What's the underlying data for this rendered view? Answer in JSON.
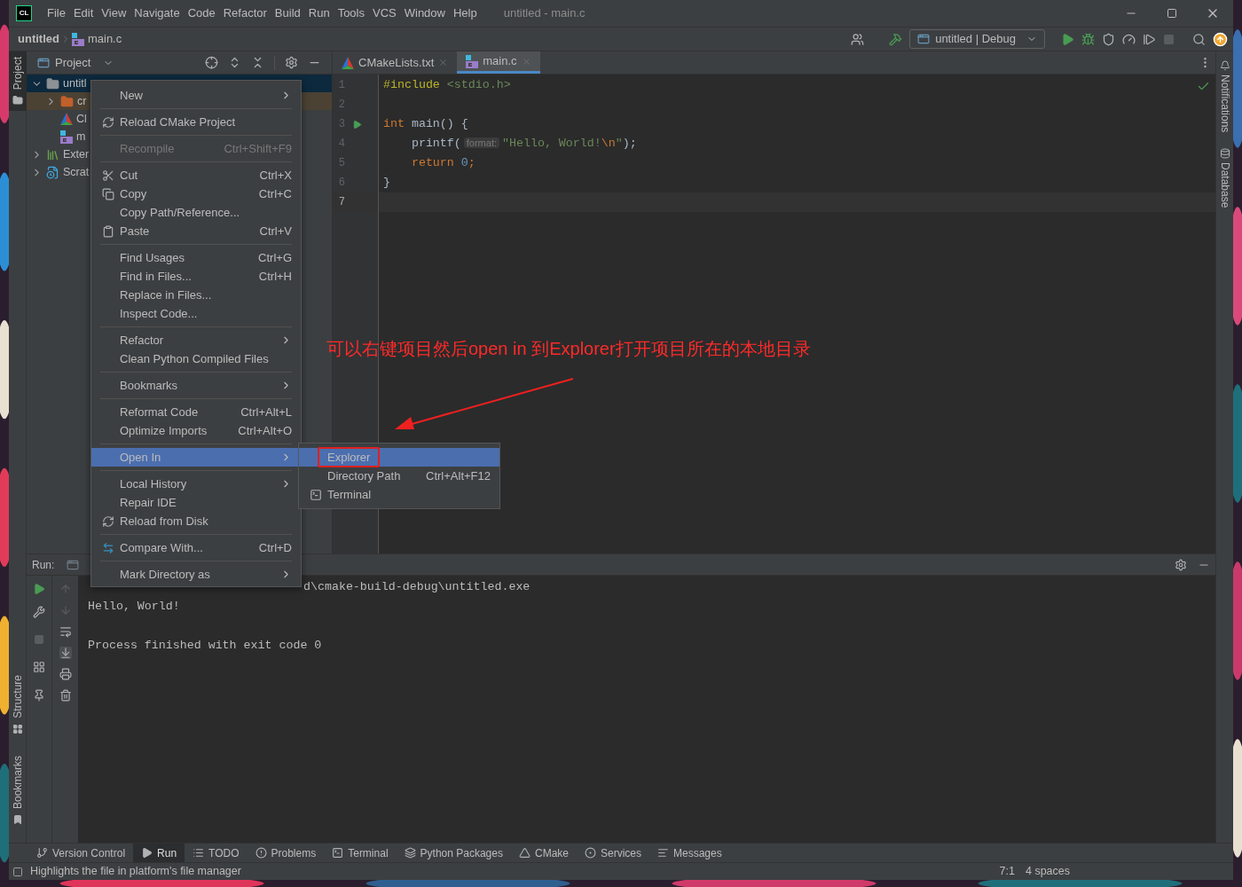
{
  "window": {
    "logo_text": "CL",
    "menu": [
      "File",
      "Edit",
      "View",
      "Navigate",
      "Code",
      "Refactor",
      "Build",
      "Run",
      "Tools",
      "VCS",
      "Window",
      "Help"
    ],
    "title": "untitled - main.c"
  },
  "breadcrumb": {
    "project": "untitled",
    "file": "main.c"
  },
  "toolbar": {
    "run_config": "untitled | Debug"
  },
  "left_stripe": [
    {
      "label": "Project",
      "selected": true
    },
    {
      "label": "Structure",
      "selected": false
    },
    {
      "label": "Bookmarks",
      "selected": false
    }
  ],
  "right_stripe": [
    {
      "label": "Notifications"
    },
    {
      "label": "Database"
    }
  ],
  "project_panel": {
    "title": "Project",
    "tree": [
      {
        "label": "untitl",
        "kind": "folder",
        "selected": true,
        "excluded": false,
        "expanded": true,
        "children": [
          {
            "label": "cr",
            "kind": "build-folder",
            "selected": false,
            "excluded": true,
            "expanded": false
          },
          {
            "label": "Cl",
            "kind": "cmake",
            "selected": false,
            "excluded": false
          },
          {
            "label": "m",
            "kind": "source",
            "selected": false,
            "excluded": false
          }
        ]
      },
      {
        "label": "Exter",
        "kind": "library",
        "selected": false,
        "excluded": false,
        "expanded": false
      },
      {
        "label": "Scrat",
        "kind": "scratch",
        "selected": false,
        "excluded": false,
        "expanded": false
      }
    ]
  },
  "editor": {
    "tabs": [
      {
        "label": "CMakeLists.txt",
        "kind": "cmake",
        "selected": false
      },
      {
        "label": "main.c",
        "kind": "source",
        "selected": true
      }
    ],
    "lines": [
      {
        "number": "1",
        "current": false,
        "run_marker": false,
        "tokens": [
          {
            "text": "#include",
            "kind": "directive"
          },
          {
            "text": " <stdio.h>",
            "kind": "string"
          }
        ]
      },
      {
        "number": "2",
        "current": false,
        "run_marker": false
      },
      {
        "number": "3",
        "current": false,
        "run_marker": true,
        "tokens": [
          {
            "text": "int",
            "kind": "keyword"
          },
          {
            "text": " main() {",
            "kind": "plain"
          }
        ]
      },
      {
        "number": "4",
        "current": false,
        "run_marker": false,
        "tokens": [
          {
            "text": "    printf(",
            "kind": "plain"
          },
          {
            "text": "format:",
            "kind": "hint"
          },
          {
            "text": "\"Hello, World!",
            "kind": "string"
          },
          {
            "text": "\\n",
            "kind": "escape"
          },
          {
            "text": "\"",
            "kind": "string"
          },
          {
            "text": ");",
            "kind": "plain"
          }
        ]
      },
      {
        "number": "5",
        "current": false,
        "run_marker": false,
        "tokens": [
          {
            "text": "    return",
            "kind": "keyword"
          },
          {
            "text": " 0",
            "kind": "number"
          },
          {
            "text": ";",
            "kind": "keyword"
          }
        ]
      },
      {
        "number": "6",
        "current": false,
        "run_marker": false,
        "tokens": [
          {
            "text": "}",
            "kind": "plain"
          }
        ]
      },
      {
        "number": "7",
        "current": true,
        "run_marker": false
      }
    ]
  },
  "run_panel": {
    "title": "Run:",
    "output": [
      {
        "text": "d\\cmake-build-debug\\untitled.exe",
        "kind": "command"
      },
      {
        "text": "Hello, World!",
        "kind": "stdout"
      },
      {
        "text": "Process finished with exit code 0",
        "kind": "exit"
      }
    ]
  },
  "context_menu": {
    "groups": [
      {
        "items": [
          {
            "label": "New",
            "submenu": true,
            "selected": false,
            "disabled": false
          }
        ]
      },
      {
        "items": [
          {
            "label": "Reload CMake Project",
            "kind": "reload",
            "submenu": false,
            "selected": false,
            "disabled": false
          }
        ]
      },
      {
        "items": [
          {
            "label": "Recompile",
            "shortcut": "Ctrl+Shift+F9",
            "submenu": false,
            "selected": false,
            "disabled": true
          }
        ]
      },
      {
        "items": [
          {
            "label": "Cut",
            "kind": "cut",
            "shortcut": "Ctrl+X",
            "submenu": false,
            "selected": false,
            "disabled": false
          },
          {
            "label": "Copy",
            "kind": "copy",
            "shortcut": "Ctrl+C",
            "submenu": false,
            "selected": false,
            "disabled": false
          },
          {
            "label": "Copy Path/Reference...",
            "submenu": false,
            "selected": false,
            "disabled": false
          },
          {
            "label": "Paste",
            "kind": "paste",
            "shortcut": "Ctrl+V",
            "submenu": false,
            "selected": false,
            "disabled": false
          }
        ]
      },
      {
        "items": [
          {
            "label": "Find Usages",
            "shortcut": "Ctrl+G",
            "submenu": false,
            "selected": false,
            "disabled": false
          },
          {
            "label": "Find in Files...",
            "shortcut": "Ctrl+H",
            "submenu": false,
            "selected": false,
            "disabled": false
          },
          {
            "label": "Replace in Files...",
            "submenu": false,
            "selected": false,
            "disabled": false
          },
          {
            "label": "Inspect Code...",
            "submenu": false,
            "selected": false,
            "disabled": false
          }
        ]
      },
      {
        "items": [
          {
            "label": "Refactor",
            "submenu": true,
            "selected": false,
            "disabled": false
          },
          {
            "label": "Clean Python Compiled Files",
            "submenu": false,
            "selected": false,
            "disabled": false
          }
        ]
      },
      {
        "items": [
          {
            "label": "Bookmarks",
            "submenu": true,
            "selected": false,
            "disabled": false
          }
        ]
      },
      {
        "items": [
          {
            "label": "Reformat Code",
            "shortcut": "Ctrl+Alt+L",
            "submenu": false,
            "selected": false,
            "disabled": false
          },
          {
            "label": "Optimize Imports",
            "shortcut": "Ctrl+Alt+O",
            "submenu": false,
            "selected": false,
            "disabled": false
          }
        ]
      },
      {
        "items": [
          {
            "label": "Open In",
            "submenu": true,
            "selected": true,
            "disabled": false
          }
        ]
      },
      {
        "items": [
          {
            "label": "Local History",
            "submenu": true,
            "selected": false,
            "disabled": false
          },
          {
            "label": "Repair IDE",
            "submenu": false,
            "selected": false,
            "disabled": false
          },
          {
            "label": "Reload from Disk",
            "kind": "reload",
            "submenu": false,
            "selected": false,
            "disabled": false
          }
        ]
      },
      {
        "items": [
          {
            "label": "Compare With...",
            "kind": "compare",
            "shortcut": "Ctrl+D",
            "submenu": false,
            "selected": false,
            "disabled": false
          }
        ]
      },
      {
        "items": [
          {
            "label": "Mark Directory as",
            "submenu": true,
            "selected": false,
            "disabled": false
          }
        ]
      }
    ]
  },
  "submenu": {
    "items": [
      {
        "label": "Explorer",
        "selected": true,
        "annotated": true
      },
      {
        "label": "Directory Path",
        "shortcut": "Ctrl+Alt+F12",
        "selected": false,
        "annotated": false
      },
      {
        "label": "Terminal",
        "kind": "terminal",
        "selected": false,
        "annotated": false
      }
    ]
  },
  "annotation": {
    "text": "可以右键项目然后open in 到Explorer打开项目所在的本地目录"
  },
  "tool_windows": [
    {
      "label": "Version Control",
      "kind": "vcs",
      "selected": false
    },
    {
      "label": "Run",
      "kind": "run",
      "selected": true
    },
    {
      "label": "TODO",
      "kind": "todo",
      "selected": false
    },
    {
      "label": "Problems",
      "kind": "problems",
      "selected": false
    },
    {
      "label": "Terminal",
      "kind": "terminal",
      "selected": false
    },
    {
      "label": "Python Packages",
      "kind": "packages",
      "selected": false
    },
    {
      "label": "CMake",
      "kind": "cmake",
      "selected": false
    },
    {
      "label": "Services",
      "kind": "services",
      "selected": false
    },
    {
      "label": "Messages",
      "kind": "messages",
      "selected": false
    }
  ],
  "status_bar": {
    "message": "Highlights the file in platform's file manager",
    "position": "7:1",
    "indent": "4 spaces"
  }
}
